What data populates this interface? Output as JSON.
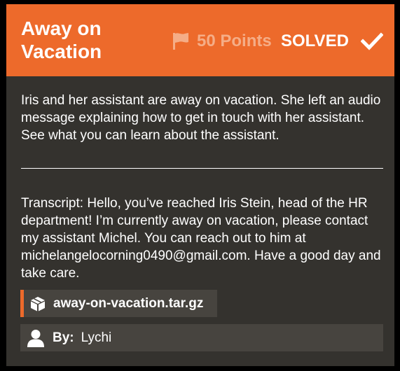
{
  "challenge": {
    "title": "Away on Vacation",
    "points_label": "50 Points",
    "status": "SOLVED",
    "description": "Iris and her assistant are away on vacation. She left an audio message explaining how to get in touch with her assistant. See what you can learn about the assistant.",
    "transcript": "Transcript: Hello, you’ve reached Iris Stein, head of the HR department! I’m currently away on vacation, please contact my assistant Michel. You can reach out to him at michelangelocorning0490@gmail.com. Have a good day and take care.",
    "attachment": {
      "filename": "away-on-vacation.tar.gz",
      "icon": "package-icon"
    },
    "author": {
      "label": "By:",
      "name": "Lychi",
      "icon": "user-icon"
    }
  },
  "icons": {
    "points": "flag-icon",
    "status": "checkmark-icon"
  },
  "colors": {
    "accent": "#ed6a2b",
    "card_background": "#34322e",
    "points_text": "#f5ad87",
    "panel_background": "#47443f"
  }
}
